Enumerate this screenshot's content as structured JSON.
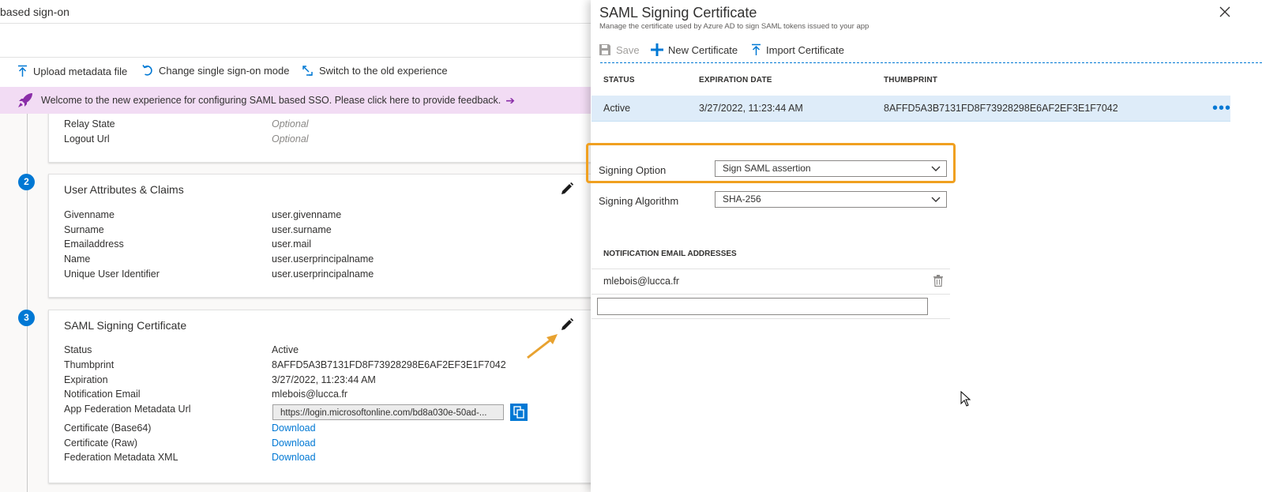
{
  "left": {
    "title": "based sign-on",
    "toolbar": {
      "upload": "Upload metadata file",
      "change_mode": "Change single sign-on mode",
      "switch": "Switch to the old experience"
    },
    "banner": "Welcome to the new experience for configuring SAML based SSO. Please click here to provide feedback.",
    "basic_config": {
      "rows": [
        {
          "k": "Relay State",
          "v": "Optional"
        },
        {
          "k": "Logout Url",
          "v": "Optional"
        }
      ]
    },
    "claims": {
      "step": "2",
      "title": "User Attributes & Claims",
      "rows": [
        {
          "k": "Givenname",
          "v": "user.givenname"
        },
        {
          "k": "Surname",
          "v": "user.surname"
        },
        {
          "k": "Emailaddress",
          "v": "user.mail"
        },
        {
          "k": "Name",
          "v": "user.userprincipalname"
        },
        {
          "k": "Unique User Identifier",
          "v": "user.userprincipalname"
        }
      ]
    },
    "cert": {
      "step": "3",
      "title": "SAML Signing Certificate",
      "status_k": "Status",
      "status_v": "Active",
      "thumb_k": "Thumbprint",
      "thumb_v": "8AFFD5A3B7131FD8F73928298E6AF2EF3E1F7042",
      "exp_k": "Expiration",
      "exp_v": "3/27/2022, 11:23:44 AM",
      "email_k": "Notification Email",
      "email_v": "mlebois@lucca.fr",
      "url_k": "App Federation Metadata Url",
      "url_v": "https://login.microsoftonline.com/bd8a030e-50ad-...",
      "b64_k": "Certificate (Base64)",
      "b64_v": "Download",
      "raw_k": "Certificate (Raw)",
      "raw_v": "Download",
      "xml_k": "Federation Metadata XML",
      "xml_v": "Download"
    }
  },
  "panel": {
    "title": "SAML Signing Certificate",
    "subtitle": "Manage the certificate used by Azure AD to sign SAML tokens issued to your app",
    "toolbar": {
      "save": "Save",
      "new_cert": "New Certificate",
      "import_cert": "Import Certificate"
    },
    "table": {
      "headers": [
        "STATUS",
        "EXPIRATION DATE",
        "THUMBPRINT"
      ],
      "row": {
        "status": "Active",
        "expiration": "3/27/2022, 11:23:44 AM",
        "thumbprint": "8AFFD5A3B7131FD8F73928298E6AF2EF3E1F7042",
        "more": "•••"
      }
    },
    "signing_option": {
      "label": "Signing Option",
      "value": "Sign SAML assertion"
    },
    "signing_algorithm": {
      "label": "Signing Algorithm",
      "value": "SHA-256"
    },
    "notification": {
      "header": "NOTIFICATION EMAIL ADDRESSES",
      "emails": [
        "mlebois@lucca.fr"
      ],
      "new_value": ""
    }
  },
  "colors": {
    "accent": "#0078d4",
    "banner": "#f2dcf4",
    "highlight": "#f0a020",
    "selected_row": "#deecf9"
  }
}
